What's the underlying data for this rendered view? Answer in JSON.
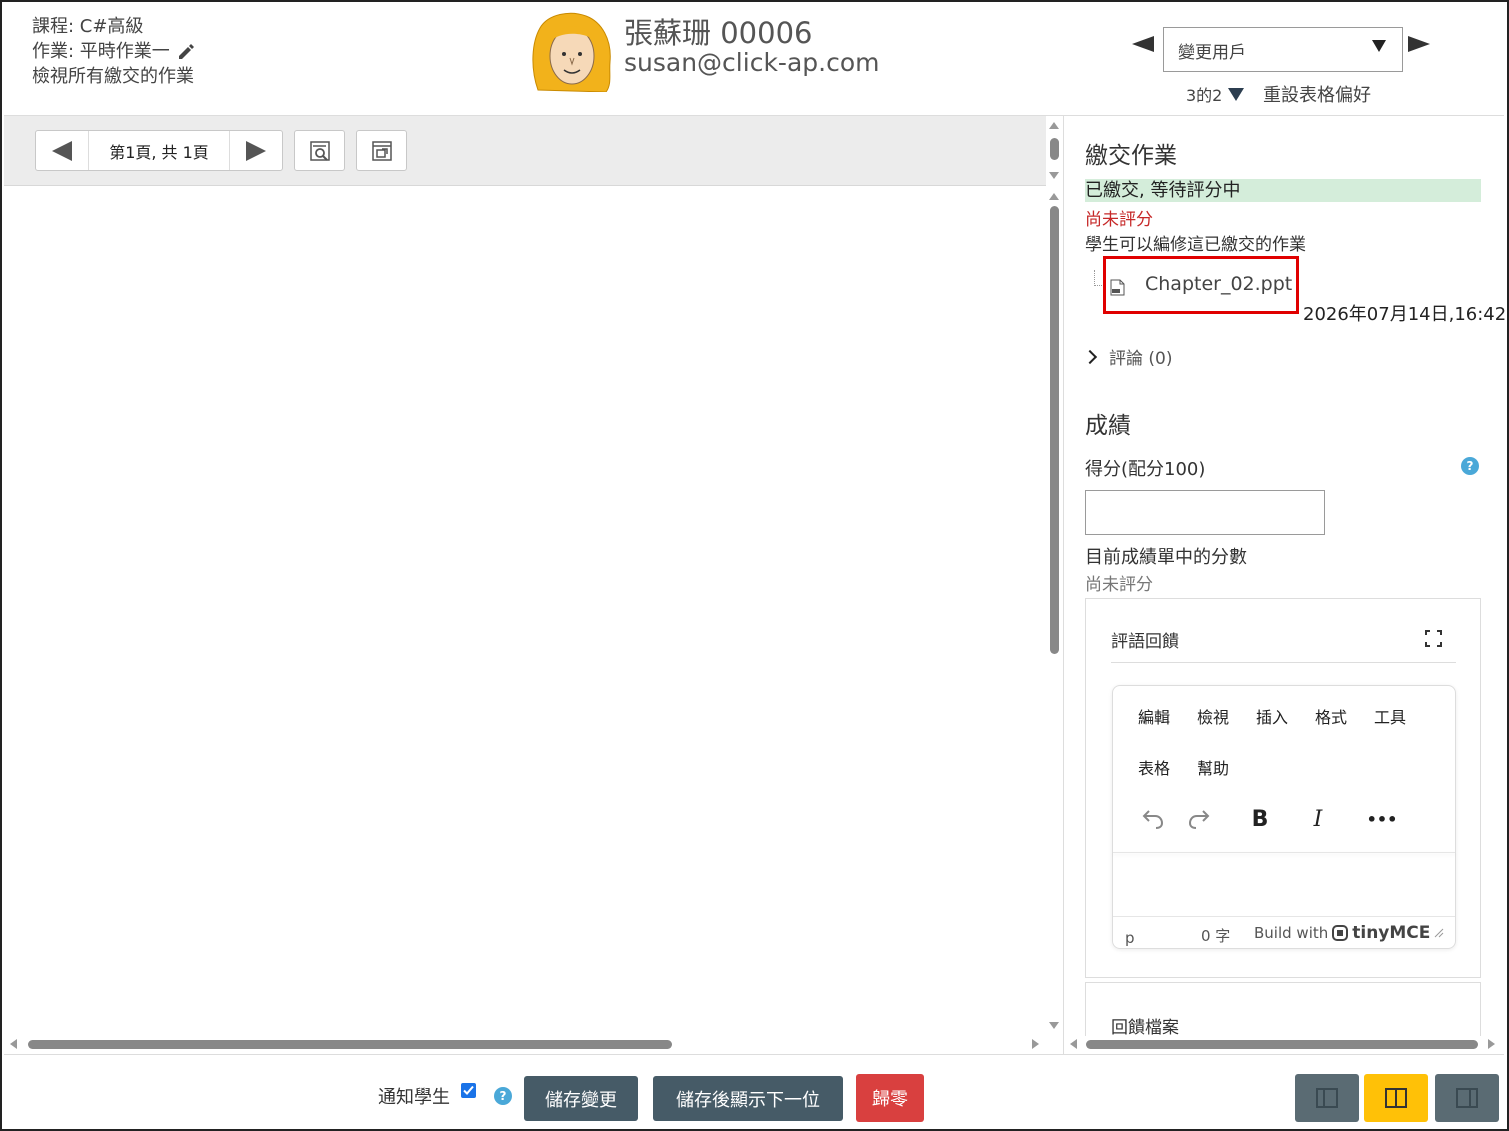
{
  "header": {
    "course": "課程: C#高級",
    "assignment": "作業: 平時作業一",
    "view_all": "檢視所有繳交的作業",
    "user_name": "張蘇珊 00006",
    "user_email": "susan@click-ap.com",
    "change_user": "變更用戶",
    "user_count": "3的2",
    "reset_prefs": "重設表格偏好"
  },
  "review_toolbar": {
    "page_label": "第1頁, 共 1頁"
  },
  "submission": {
    "heading": "繳交作業",
    "status": "已繳交, 等待評分中",
    "grading_status": "尚未評分",
    "edit_note": "學生可以編修這已繳交的作業",
    "file_name": "Chapter_02.ppt",
    "file_time": "2026年07月14日,16:42",
    "comments": "評論 (0)"
  },
  "grade": {
    "heading": "成績",
    "score_label": "得分(配分100)",
    "score_value": "",
    "current_label": "目前成績單中的分數",
    "current_value": "尚未評分"
  },
  "feedback": {
    "title": "評語回饋",
    "menu": [
      "編輯",
      "檢視",
      "插入",
      "格式",
      "工具",
      "表格",
      "幫助"
    ],
    "bold": "B",
    "italic": "I",
    "more": "•••",
    "status_tag": "p",
    "word_count": "0 字",
    "build_with": "Build with",
    "brand": "tinyMCE",
    "files_title": "回饋檔案"
  },
  "actions": {
    "notify": "通知學生",
    "save": "儲存變更",
    "save_next": "儲存後顯示下一位",
    "reset": "歸零"
  },
  "colors": {
    "status_bg": "#d4edda",
    "not_graded": "#c62828",
    "dark_button": "#465b67",
    "reset_button": "#d9403f",
    "layout_active": "#ffc107",
    "layout_inactive": "#5a6b73",
    "highlight_box": "#e00000"
  }
}
